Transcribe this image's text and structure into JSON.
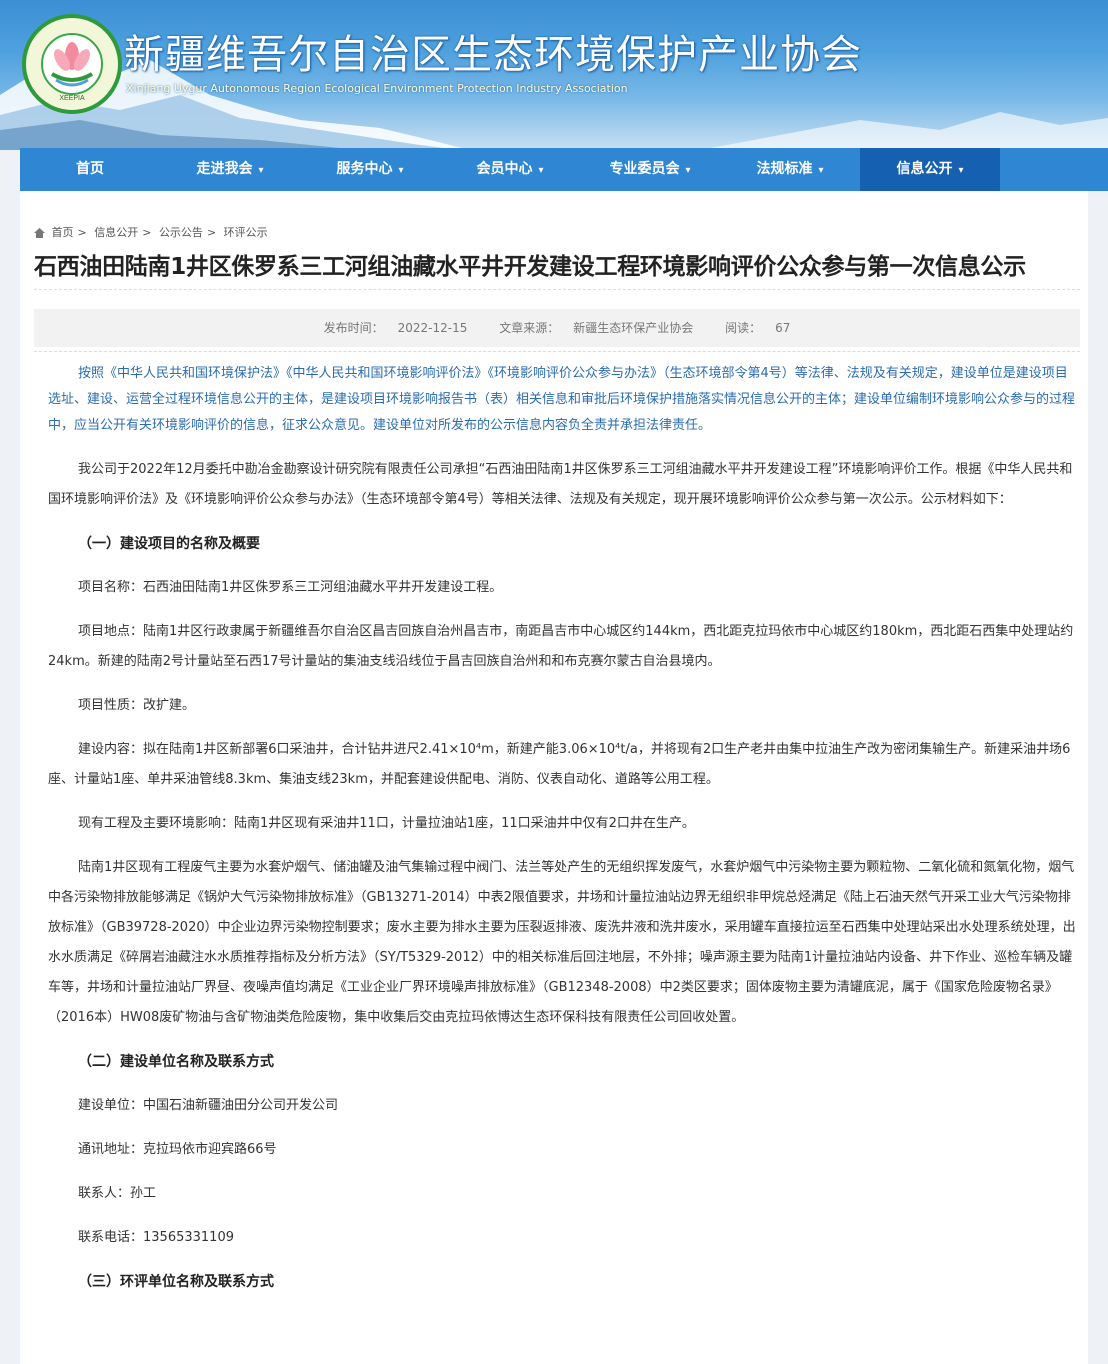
{
  "header": {
    "site_title": "新疆维吾尔自治区生态环境保护产业协会",
    "site_subtitle": "Xinjiang Uygur Autonomous Region Ecological Environment Protection Industry Association"
  },
  "nav": {
    "items": [
      {
        "label": "首页",
        "dropdown": false
      },
      {
        "label": "走进我会",
        "dropdown": true
      },
      {
        "label": "服务中心",
        "dropdown": true
      },
      {
        "label": "会员中心",
        "dropdown": true
      },
      {
        "label": "专业委员会",
        "dropdown": true
      },
      {
        "label": "法规标准",
        "dropdown": true
      },
      {
        "label": "信息公开",
        "dropdown": true,
        "active": true
      }
    ]
  },
  "breadcrumb": [
    "首页",
    "信息公开",
    "公示公告",
    "环评公示"
  ],
  "article": {
    "title": "石西油田陆南1井区侏罗系三工河组油藏水平井开发建设工程环境影响评价公众参与第一次信息公示",
    "meta": {
      "published_label": "发布时间：",
      "published": "2022-12-15",
      "source_label": "文章来源：",
      "source": "新疆生态环保产业协会",
      "reads_label": "阅读：",
      "reads": "67"
    },
    "intro": "按照《中华人民共和国环境保护法》《中华人民共和国环境影响评价法》《环境影响评价公众参与办法》（生态环境部令第4号）等法律、法规及有关规定，建设单位是建设项目选址、建设、运营全过程环境信息公开的主体，是建设项目环境影响报告书（表）相关信息和审批后环境保护措施落实情况信息公开的主体；建设单位编制环境影响公众参与的过程中，应当公开有关环境影响评价的信息，征求公众意见。建设单位对所发布的公示信息内容负全责并承担法律责任。",
    "para1": "我公司于2022年12月委托中勘冶金勘察设计研究院有限责任公司承担“石西油田陆南1井区侏罗系三工河组油藏水平井开发建设工程”环境影响评价工作。根据《中华人民共和国环境影响评价法》及《环境影响评价公众参与办法》（生态环境部令第4号）等相关法律、法规及有关规定，现开展环境影响评价公众参与第一次公示。公示材料如下：",
    "section1": "（一）建设项目的名称及概要",
    "project_name": "项目名称：石西油田陆南1井区侏罗系三工河组油藏水平井开发建设工程。",
    "project_location": "项目地点：陆南1井区行政隶属于新疆维吾尔自治区昌吉回族自治州昌吉市，南距昌吉市中心城区约144km，西北距克拉玛依市中心城区约180km，西北距石西集中处理站约24km。新建的陆南2号计量站至石西17号计量站的集油支线沿线位于昌吉回族自治州和和布克赛尔蒙古自治县境内。",
    "project_nature": "项目性质：改扩建。",
    "project_content": "建设内容：拟在陆南1井区新部署6口采油井，合计钻井进尺2.41×10⁴m，新建产能3.06×10⁴t/a，并将现有2口生产老井由集中拉油生产改为密闭集输生产。新建采油井场6座、计量站1座、单井采油管线8.3km、集油支线23km，并配套建设供配电、消防、仪表自动化、道路等公用工程。",
    "existing": "现有工程及主要环境影响：陆南1井区现有采油井11口，计量拉油站1座，11口采油井中仅有2口井在生产。",
    "existing_detail": "陆南1井区现有工程废气主要为水套炉烟气、储油罐及油气集输过程中阀门、法兰等处产生的无组织挥发废气，水套炉烟气中污染物主要为颗粒物、二氧化硫和氮氧化物，烟气中各污染物排放能够满足《锅炉大气污染物排放标准》（GB13271-2014）中表2限值要求，井场和计量拉油站边界无组织非甲烷总烃满足《陆上石油天然气开采工业大气污染物排放标准》（GB39728-2020）中企业边界污染物控制要求；废水主要为排水主要为压裂返排液、废洗井液和洗井废水，采用罐车直接拉运至石西集中处理站采出水处理系统处理，出水水质满足《碎屑岩油藏注水水质推荐指标及分析方法》（SY/T5329-2012）中的相关标准后回注地层，不外排；噪声源主要为陆南1计量拉油站内设备、井下作业、巡检车辆及罐车等，井场和计量拉油站厂界昼、夜噪声值均满足《工业企业厂界环境噪声排放标准》（GB12348-2008）中2类区要求；固体废物主要为清罐底泥，属于《国家危险废物名录》（2016本）HW08废矿物油与含矿物油类危险废物，集中收集后交由克拉玛依博达生态环保科技有限责任公司回收处置。",
    "section2": "（二）建设单位名称及联系方式",
    "builder": "建设单位：中国石油新疆油田分公司开发公司",
    "address": "通讯地址：克拉玛依市迎宾路66号",
    "contact": "联系人：孙工",
    "phone": "联系电话：13565331109",
    "section3": "（三）环评单位名称及联系方式"
  },
  "colors": {
    "nav_bg": "#2f86d3",
    "nav_active": "#1660b1",
    "intro_text": "#2b6cb0"
  }
}
